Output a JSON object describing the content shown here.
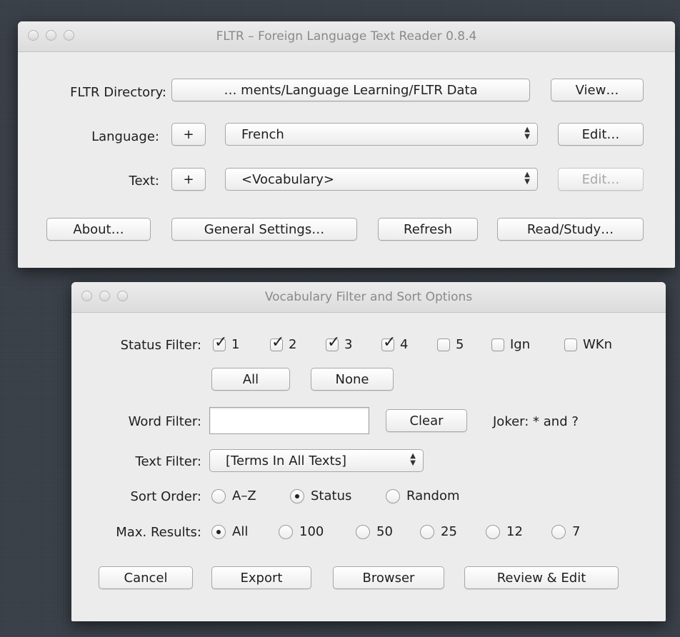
{
  "main_window": {
    "title": "FLTR – Foreign Language Text Reader 0.8.4",
    "directory_label": "FLTR Directory:",
    "directory_value": "… ments/Language Learning/FLTR Data",
    "view_button": "View…",
    "language_label": "Language:",
    "add_language": "+",
    "language_value": "French",
    "edit_language": "Edit…",
    "text_label": "Text:",
    "add_text": "+",
    "text_value": "<Vocabulary>",
    "edit_text": "Edit…",
    "about_button": "About…",
    "settings_button": "General Settings…",
    "refresh_button": "Refresh",
    "read_button": "Read/Study…"
  },
  "filter_window": {
    "title": "Vocabulary Filter and Sort Options",
    "status_filter_label": "Status Filter:",
    "status_options": [
      {
        "label": "1",
        "checked": true
      },
      {
        "label": "2",
        "checked": true
      },
      {
        "label": "3",
        "checked": true
      },
      {
        "label": "4",
        "checked": true
      },
      {
        "label": "5",
        "checked": false
      },
      {
        "label": "Ign",
        "checked": false
      },
      {
        "label": "WKn",
        "checked": false
      }
    ],
    "all_button": "All",
    "none_button": "None",
    "word_filter_label": "Word Filter:",
    "word_filter_value": "",
    "clear_button": "Clear",
    "joker_hint": "Joker: * and ?",
    "text_filter_label": "Text Filter:",
    "text_filter_value": "[Terms In All Texts]",
    "sort_order_label": "Sort Order:",
    "sort_options": [
      {
        "label": "A–Z",
        "selected": false
      },
      {
        "label": "Status",
        "selected": true
      },
      {
        "label": "Random",
        "selected": false
      }
    ],
    "max_results_label": "Max. Results:",
    "max_options": [
      {
        "label": "All",
        "selected": true
      },
      {
        "label": "100",
        "selected": false
      },
      {
        "label": "50",
        "selected": false
      },
      {
        "label": "25",
        "selected": false
      },
      {
        "label": "12",
        "selected": false
      },
      {
        "label": "7",
        "selected": false
      }
    ],
    "cancel_button": "Cancel",
    "export_button": "Export",
    "browser_button": "Browser",
    "review_button": "Review & Edit"
  },
  "colors": {
    "window_bg": "#ececec",
    "desktop_bg": "#3a4049"
  },
  "icons": {
    "traffic_light": "window-control-icon",
    "checkmark": "checkmark-icon",
    "stepper": "select-arrows-icon"
  }
}
